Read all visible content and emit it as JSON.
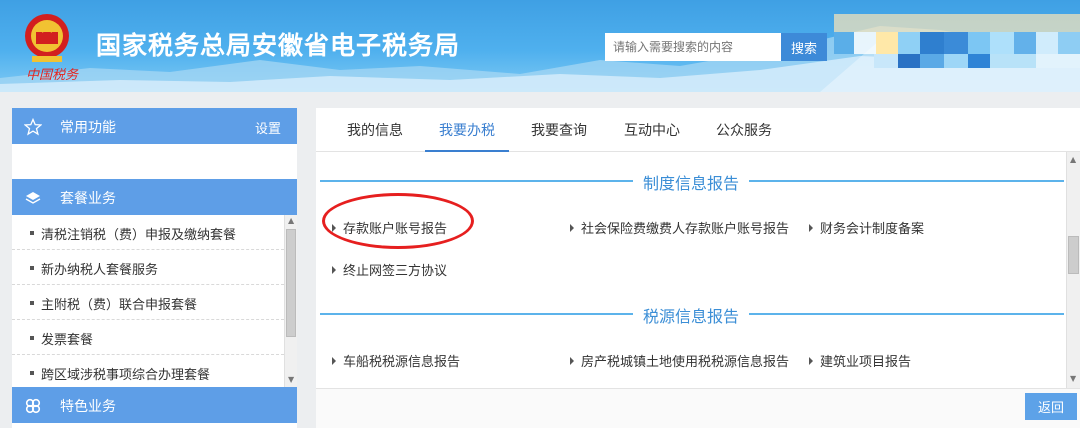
{
  "header": {
    "title": "国家税务总局安徽省电子税务局",
    "search_placeholder": "请输入需要搜索的内容",
    "search_button": "搜索",
    "emblem_caption": "中国税务",
    "colors": {
      "banner": "#4fb0ee",
      "button": "#3d8ad8"
    }
  },
  "sidebar": {
    "common": {
      "label": "常用功能",
      "settings": "设置",
      "icon": "star-icon"
    },
    "package": {
      "label": "套餐业务",
      "icon": "layers-icon"
    },
    "items": [
      "清税注销税（费）申报及缴纳套餐",
      "新办纳税人套餐服务",
      "主附税（费）联合申报套餐",
      "发票套餐",
      "跨区域涉税事项综合办理套餐"
    ],
    "special": {
      "label": "特色业务",
      "icon": "clover-icon"
    }
  },
  "tabs": [
    "我的信息",
    "我要办税",
    "我要查询",
    "互动中心",
    "公众服务"
  ],
  "active_tab": "我要办税",
  "sections": [
    {
      "title": "制度信息报告",
      "links": [
        "存款账户账号报告",
        "社会保险费缴费人存款账户账号报告",
        "财务会计制度备案",
        "终止网签三方协议"
      ]
    },
    {
      "title": "税源信息报告",
      "links": [
        "车船税税源信息报告",
        "房产税城镇土地使用税税源信息报告",
        "建筑业项目报告"
      ]
    }
  ],
  "back_button": "返回",
  "highlight_color": "#e61f1f"
}
